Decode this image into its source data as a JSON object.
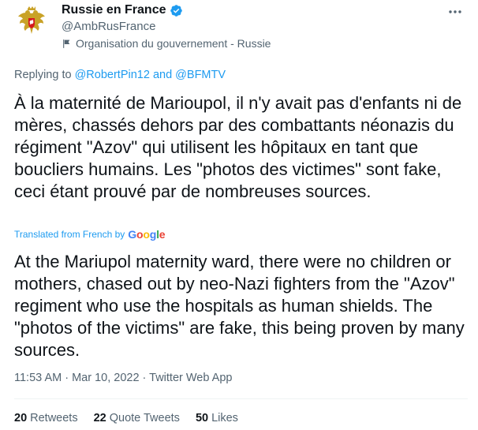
{
  "account": {
    "display_name": "Russie en France",
    "handle": "@AmbRusFrance",
    "affiliation": "Organisation du gouvernement - Russie"
  },
  "reply": {
    "prefix": "Replying to",
    "mention_1": "@RobertPin12",
    "conjunction": "and",
    "mention_2": "@BFMTV"
  },
  "tweet": {
    "text_fr": "À la maternité de Marioupol, il n'y avait pas d'enfants ni de mères, chassés dehors par des combattants néonazis du régiment \"Azov\" qui utilisent les hôpitaux en tant que boucliers humains. Les \"photos des victimes\" sont fake, ceci étant prouvé par de nombreuses sources.",
    "translated_label": "Translated from French by",
    "translator_g1": "G",
    "translator_o1": "o",
    "translator_o2": "o",
    "translator_g2": "g",
    "translator_l": "l",
    "translator_e": "e",
    "text_en": "At the Mariupol maternity ward, there were no children or mothers, chased out by neo-Nazi fighters from the \"Azov\" regiment who use the hospitals as human shields. The \"photos of the victims\" are fake, this being proven by many sources.",
    "timestamp": "11:53 AM · Mar 10, 2022 · Twitter Web App"
  },
  "stats": {
    "retweets_count": "20",
    "retweets_label": "Retweets",
    "quotes_count": "22",
    "quotes_label": "Quote Tweets",
    "likes_count": "50",
    "likes_label": "Likes"
  },
  "colors": {
    "link": "#1d9bf0",
    "secondary_text": "#536471",
    "primary_text": "#0f1419",
    "verified_badge": "#1d9bf0"
  },
  "icons": {
    "avatar": "russian-coat-of-arms-icon",
    "verified": "verified-badge-icon",
    "affiliation": "flag-icon",
    "more": "more-options-icon"
  }
}
